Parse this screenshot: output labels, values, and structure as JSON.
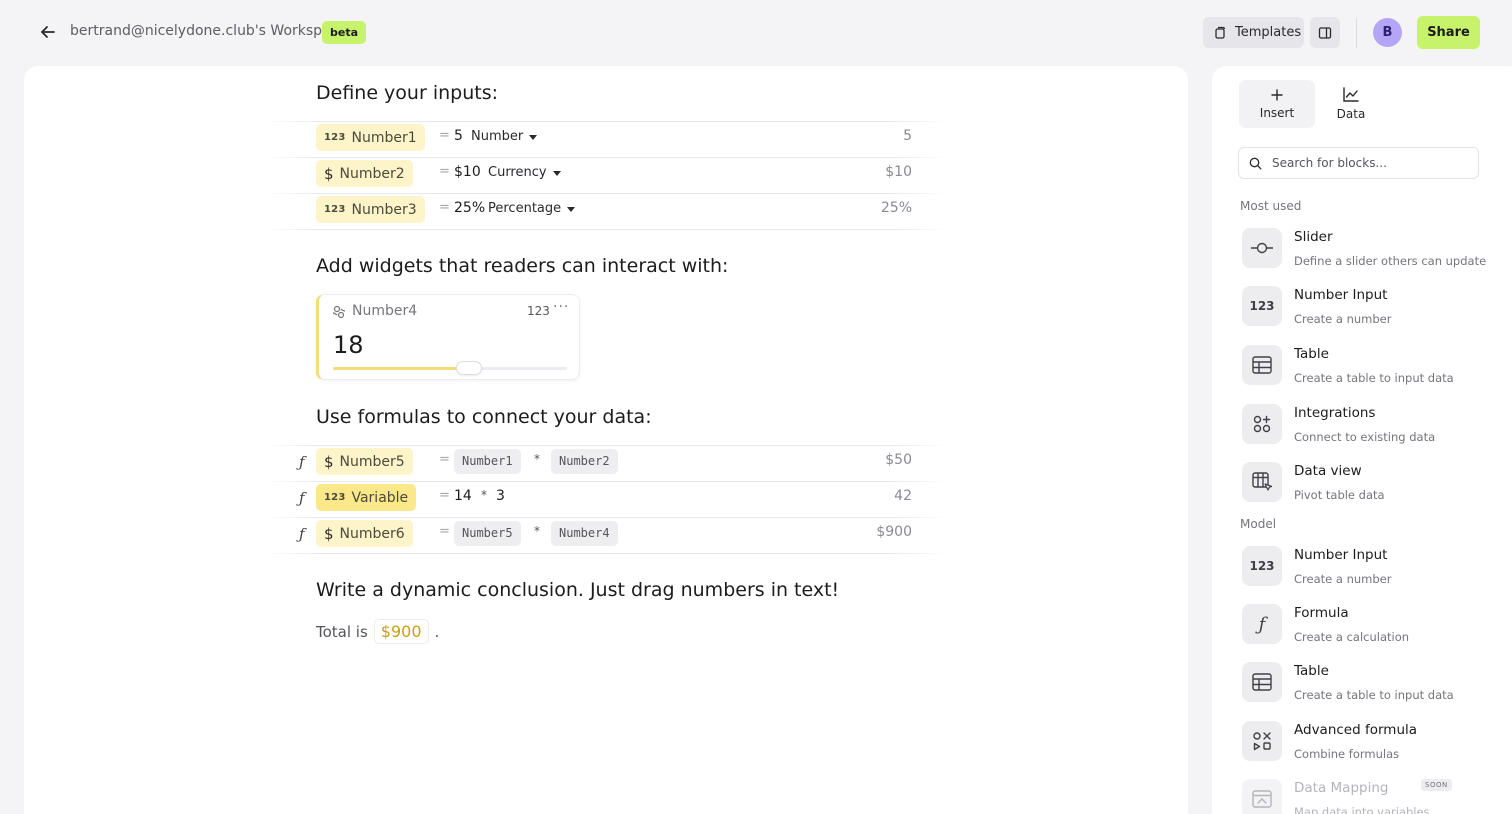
{
  "header": {
    "workspace_title": "bertrand@nicelydone.club's Workspace",
    "beta_badge": "beta",
    "templates_label": "Templates",
    "avatar_initial": "B",
    "share_label": "Share"
  },
  "colors": {
    "accent_green": "#c7f26c",
    "chip_yellow": "#fdf5c9",
    "avatar_purple": "#b4a5f6",
    "highlight_gold": "#c9a012"
  },
  "document": {
    "sections": {
      "inputs_title": "Define your inputs:",
      "widgets_title": "Add widgets that readers can interact with:",
      "formulas_title": "Use formulas to connect your data:",
      "conclusion_title": "Write a dynamic conclusion. Just drag numbers in text!"
    },
    "inputs": [
      {
        "badge": "123",
        "name": "Number1",
        "eq": "=",
        "value": "5",
        "format": "Number",
        "result": "5"
      },
      {
        "badge": "$",
        "name": "Number2",
        "eq": "=",
        "value": "$10",
        "format": "Currency",
        "result": "$10"
      },
      {
        "badge": "123",
        "name": "Number3",
        "eq": "=",
        "value": "25%",
        "format": "Percentage",
        "result": "25%"
      }
    ],
    "widget": {
      "name": "Number4",
      "type_label": "123",
      "more": "···",
      "value": "18",
      "slider_fraction": 0.58
    },
    "formulas": [
      {
        "fx": "ƒ",
        "badge": "$",
        "name": "Number5",
        "eq": "=",
        "left": "Number1",
        "op": "*",
        "right": "Number2",
        "result": "$50"
      },
      {
        "fx": "ƒ",
        "badge": "123",
        "name": "Variable",
        "eq": "=",
        "left": "14",
        "op": "*",
        "right": "3",
        "result": "42"
      },
      {
        "fx": "ƒ",
        "badge": "$",
        "name": "Number6",
        "eq": "=",
        "left": "Number5",
        "op": "*",
        "right": "Number4",
        "result": "$900"
      }
    ],
    "conclusion": {
      "prefix": "Total is",
      "value": "$900",
      "suffix": "."
    }
  },
  "sidebar": {
    "tabs": [
      {
        "label": "Insert",
        "icon": "plus-icon"
      },
      {
        "label": "Data",
        "icon": "chart-icon"
      }
    ],
    "search_placeholder": "Search for blocks...",
    "group_most_used": "Most used",
    "group_model": "Model",
    "most_used": [
      {
        "title": "Slider",
        "desc": "Define a slider others can update",
        "icon": "slider-icon"
      },
      {
        "title": "Number Input",
        "desc": "Create a number",
        "icon": "number-icon",
        "icon_text": "123"
      },
      {
        "title": "Table",
        "desc": "Create a table to input data",
        "icon": "table-icon"
      },
      {
        "title": "Integrations",
        "desc": "Connect to existing data",
        "icon": "integrations-icon"
      },
      {
        "title": "Data view",
        "desc": "Pivot table data",
        "icon": "data-view-icon"
      }
    ],
    "model": [
      {
        "title": "Number Input",
        "desc": "Create a number",
        "icon": "number-icon",
        "icon_text": "123"
      },
      {
        "title": "Formula",
        "desc": "Create a calculation",
        "icon": "formula-icon",
        "icon_text": "ƒ"
      },
      {
        "title": "Table",
        "desc": "Create a table to input data",
        "icon": "table-icon"
      },
      {
        "title": "Advanced formula",
        "desc": "Combine formulas",
        "icon": "advanced-formula-icon"
      },
      {
        "title": "Data Mapping",
        "desc": "Map data into variables",
        "icon": "data-mapping-icon",
        "badge": "SOON"
      }
    ]
  }
}
